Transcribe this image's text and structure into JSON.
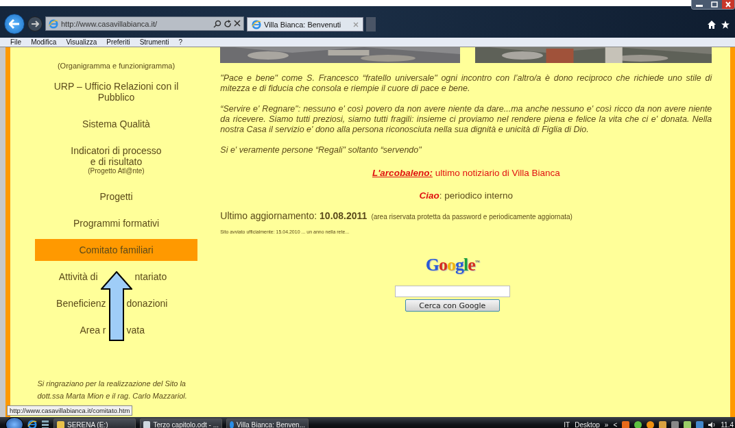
{
  "browser": {
    "address": "http://www.casavillabianca.it/",
    "tabs": [
      {
        "label": "Villa Bianca: Benvenuti",
        "selected": true
      }
    ],
    "menu": [
      "File",
      "Modifica",
      "Visualizza",
      "Preferiti",
      "Strumenti",
      "?"
    ]
  },
  "sidebar": {
    "items": [
      {
        "kind": "caption",
        "lines": [
          "(Organigramma e funzionigramma)"
        ],
        "selected": false
      },
      {
        "kind": "link",
        "lines": [
          "URP – Ufficio Relazioni con il",
          "Pubblico"
        ],
        "selected": false
      },
      {
        "kind": "link",
        "lines": [
          "Sistema Qualità"
        ],
        "selected": false
      },
      {
        "kind": "link",
        "lines": [
          "Indicatori di processo",
          "e di risultato"
        ],
        "note": "(Progetto Atl@nte)",
        "selected": false
      },
      {
        "kind": "link",
        "lines": [
          "Progetti"
        ],
        "selected": false
      },
      {
        "kind": "link",
        "lines": [
          "Programmi formativi"
        ],
        "selected": false
      },
      {
        "kind": "link",
        "lines": [
          "Comitato familiari"
        ],
        "selected": true
      },
      {
        "kind": "covered",
        "parts": [
          "Attività di",
          "ntariato"
        ],
        "selected": false
      },
      {
        "kind": "covered",
        "parts": [
          "Beneficienz",
          "donazioni"
        ],
        "selected": false
      },
      {
        "kind": "covered",
        "parts": [
          "Area r",
          "vata"
        ],
        "selected": false
      }
    ],
    "credits": [
      "Si ringraziano per la realizzazione del Sito la",
      "dott.ssa Marta Mion e il rag. Carlo Mazzariol."
    ]
  },
  "content": {
    "paragraphs": [
      "\"Pace e bene\" come S. Francesco “fratello universale\" ogni incontro con l’altro/a è dono reciproco che richiede uno stile di mitezza e di fiducia che consola e riempie il cuore di pace e bene.",
      "“Servire e' Regnare\": nessuno e' così povero da non avere niente da dare...ma anche nessuno e' così ricco da non avere niente da ricevere. Siamo tutti preziosi, siamo tutti fragili: insieme ci proviamo nel rendere piena e felice la vita che ci e' donata. Nella nostra Casa il servizio e' dono alla persona riconosciuta nella sua dignità e unicità di Figlia di Dio.",
      "Si e' veramente persone “Regali\" soltanto “servendo\""
    ],
    "links": [
      {
        "link": "L'arcobaleno:",
        "text": "ultimo notiziario di Villa Bianca",
        "color": "#e01010"
      },
      {
        "link": "Ciao",
        "text": ": periodico interno",
        "color": "#5b4a1a"
      }
    ],
    "update": {
      "text": "Ultimo aggiornamento: **10.08.2011**",
      "note": "(area riservata protetta da password e periodicamente aggiornata)"
    },
    "launch": "Sito avviato ufficialmente: 15.04.2010 ... un anno nella rete...",
    "search": {
      "logo": "Google",
      "logo_mark": "™",
      "button": "Cerca con Google"
    }
  },
  "status_tooltip": "http://www.casavillabianca.it/comitato.htm",
  "taskbar": {
    "buttons": [
      {
        "label": "SERENA (E:)",
        "kind": "folder"
      },
      {
        "label": "Terzo capitolo.odt - ...",
        "kind": "document"
      },
      {
        "label": "Villa Bianca: Benven...",
        "kind": "browser"
      }
    ],
    "language": "IT",
    "toolbar": "Desktop",
    "chevron": "»",
    "expand": "<",
    "clock": "11.4"
  }
}
